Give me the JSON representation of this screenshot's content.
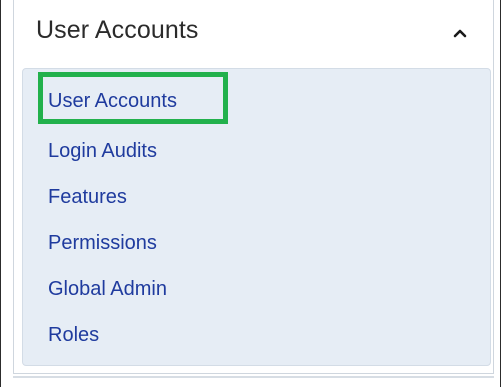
{
  "panel": {
    "title": "User Accounts",
    "collapse_icon": "chevron-up-icon"
  },
  "menu": {
    "items": [
      {
        "label": "User Accounts",
        "highlighted": true
      },
      {
        "label": "Login Audits"
      },
      {
        "label": "Features"
      },
      {
        "label": "Permissions"
      },
      {
        "label": "Global Admin"
      },
      {
        "label": "Roles"
      }
    ]
  },
  "colors": {
    "link": "#1f3b9e",
    "menu_background": "#e6edf5",
    "highlight_border": "#22b14c",
    "title_text": "#2b2b2b"
  }
}
